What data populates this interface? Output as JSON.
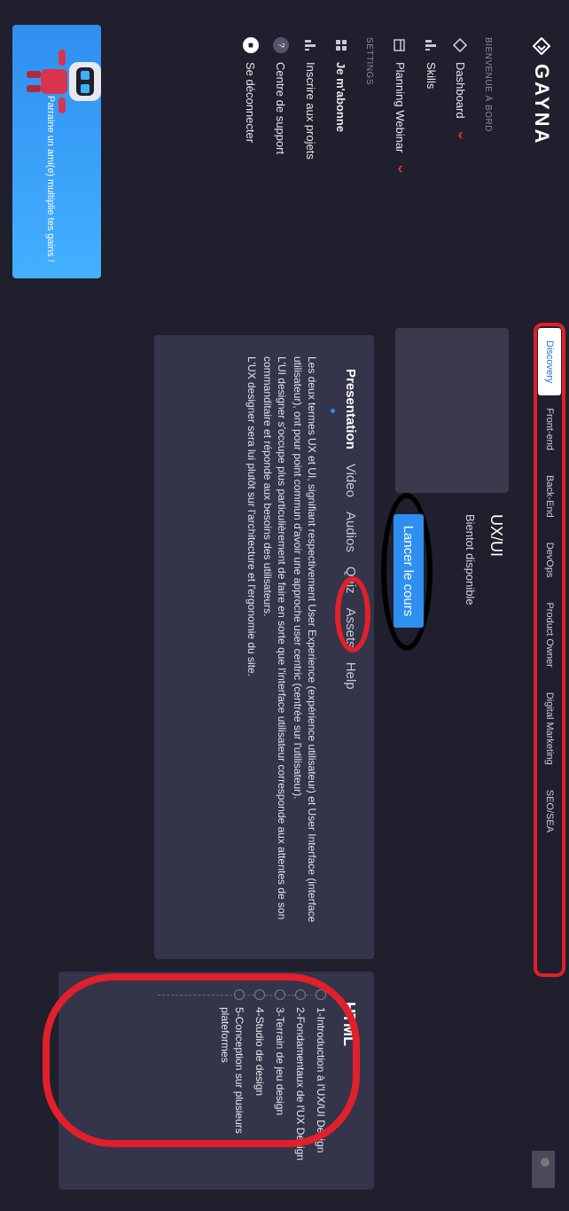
{
  "brand": {
    "name": "GAYNA"
  },
  "sidebar": {
    "section_welcome": "BIENVENUE À BORD",
    "items": [
      {
        "label": "Dashboard",
        "icon": "diamond-icon",
        "has_chevron": true
      },
      {
        "label": "Skills",
        "icon": "bar-chart-icon",
        "has_chevron": false
      },
      {
        "label": "Planning Webinar",
        "icon": "calendar-icon",
        "has_chevron": true
      }
    ],
    "section_settings": "SETTINGS",
    "settings_items": [
      {
        "label": "Je m'abonne",
        "icon": "grid-icon"
      },
      {
        "label": "Inscrire aux projets",
        "icon": "bar-chart-icon"
      },
      {
        "label": "Centre de support",
        "icon": "help-icon"
      },
      {
        "label": "Se déconnecter",
        "icon": "lock-icon"
      }
    ],
    "promo": {
      "text": "Parraine un ami(e) multiplie tes gains !"
    }
  },
  "categories": [
    "Discovery",
    "Front-end",
    "Back-End",
    "DevOps",
    "Product Owner",
    "Digital Marketing",
    "SEO/SEA"
  ],
  "active_category": "Discovery",
  "course": {
    "title": "UX/UI",
    "subtitle": "Bientot disponible",
    "launch_label": "Lancer le cours"
  },
  "content_tabs": [
    "Presentation",
    "Video",
    "Audios",
    "Quiz",
    "Assets",
    "Help"
  ],
  "active_content_tab": "Presentation",
  "presentation": [
    "Les deux termes UX et UI, signifiant respectivement User Experience (expérience utilisateur) et User Interface (interface utilisateur), ont pour point commun d'avoir une approche user centric (centrée sur l'utilisateur).",
    "L'UI designer s'occupe plus particulièrement de faire en sorte que l'interface utilisateur corresponde aux attentes de son commanditaire et réponde aux besoins des utilisateurs.",
    "L'UX designer sera lui plutôt sur l'architecture et l'ergonomie du site."
  ],
  "chapters": {
    "title": "HTML",
    "items": [
      "1-Introduction à l'UX/UI Design",
      "2-Fondamentaux de l'UX Design",
      "3-Terrain de jeu design",
      "4-Studio de design",
      "5-Conception sur plusieurs plateformes"
    ]
  },
  "colors": {
    "accent": "#2f8ff0",
    "annotation_red": "#e0202a",
    "background": "#1f1f2d",
    "panel": "#34344a"
  }
}
